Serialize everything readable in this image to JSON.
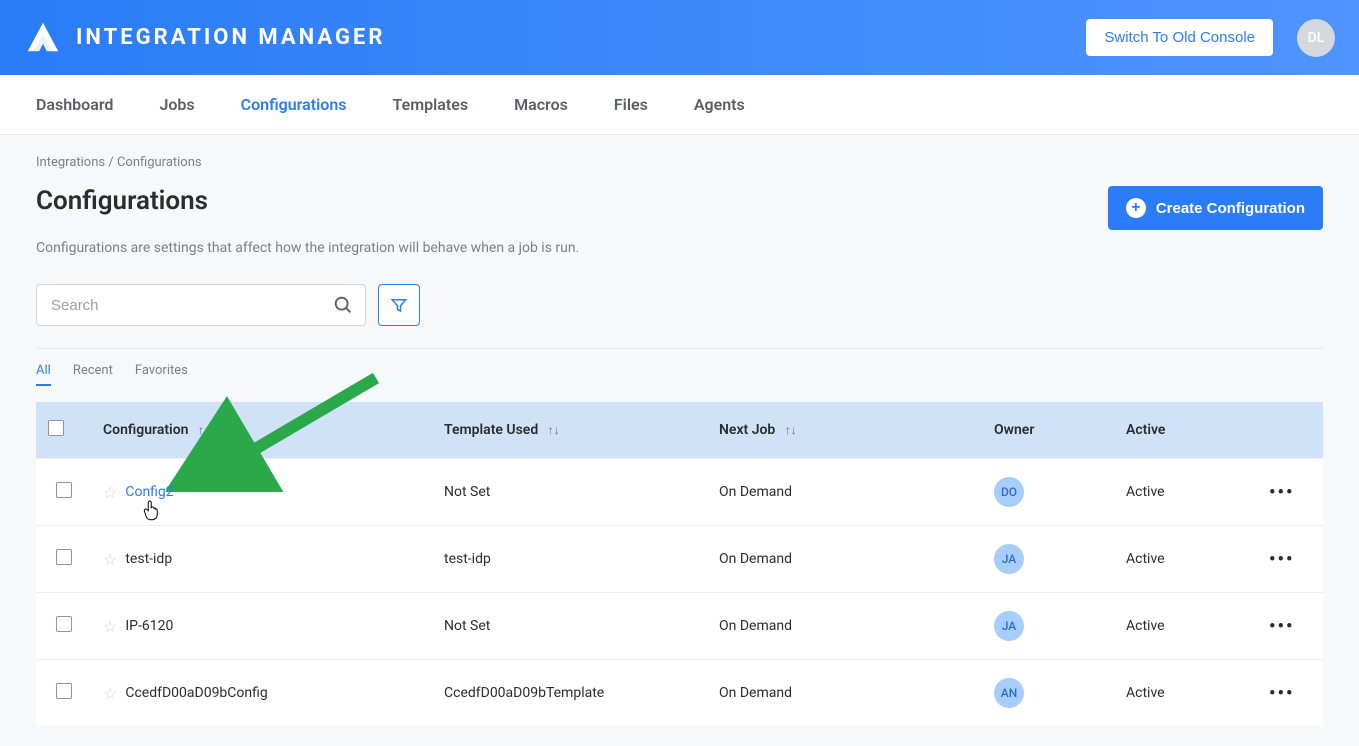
{
  "header": {
    "brand": "INTEGRATION MANAGER",
    "switch_label": "Switch To Old Console",
    "avatar_initials": "DL"
  },
  "nav": {
    "items": [
      "Dashboard",
      "Jobs",
      "Configurations",
      "Templates",
      "Macros",
      "Files",
      "Agents"
    ],
    "active_index": 2
  },
  "breadcrumb": {
    "root": "Integrations",
    "sep": " / ",
    "current": "Configurations"
  },
  "page": {
    "title": "Configurations",
    "description": "Configurations are settings that affect how the integration will behave when a job is run.",
    "create_label": "Create Configuration"
  },
  "search": {
    "placeholder": "Search"
  },
  "tabs": {
    "items": [
      "All",
      "Recent",
      "Favorites"
    ],
    "active_index": 0
  },
  "table": {
    "columns": {
      "configuration": "Configuration",
      "template": "Template Used",
      "next_job": "Next Job",
      "owner": "Owner",
      "active": "Active"
    },
    "rows": [
      {
        "name": "Config2",
        "name_is_link": true,
        "show_cursor": true,
        "template": "Not Set",
        "next_job": "On Demand",
        "owner": "DO",
        "active": "Active"
      },
      {
        "name": "test-idp",
        "name_is_link": false,
        "show_cursor": false,
        "template": "test-idp",
        "next_job": "On Demand",
        "owner": "JA",
        "active": "Active"
      },
      {
        "name": "IP-6120",
        "name_is_link": false,
        "show_cursor": false,
        "template": "Not Set",
        "next_job": "On Demand",
        "owner": "JA",
        "active": "Active"
      },
      {
        "name": "CcedfD00aD09bConfig",
        "name_is_link": false,
        "show_cursor": false,
        "template": "CcedfD00aD09bTemplate",
        "next_job": "On Demand",
        "owner": "AN",
        "active": "Active"
      }
    ]
  }
}
